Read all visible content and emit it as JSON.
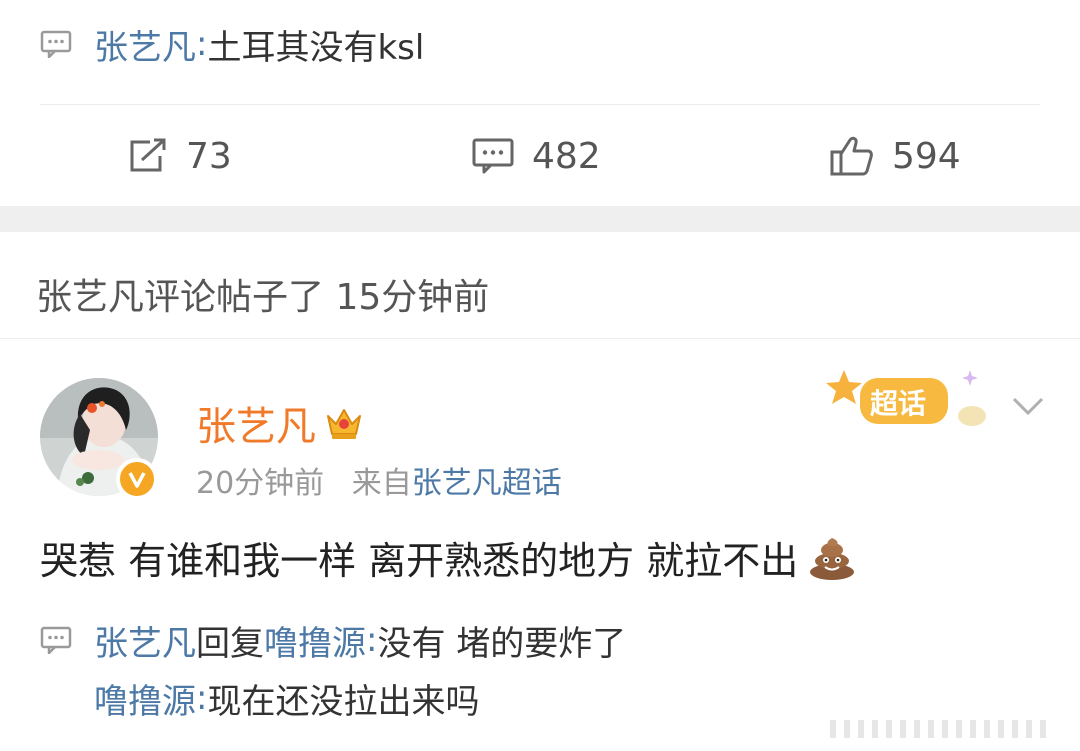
{
  "top_comment": {
    "icon": "comment-bubble-icon",
    "user": "张艺凡",
    "sep": ": ",
    "text": "土耳其没有ksl"
  },
  "actions": {
    "repost": {
      "icon": "repost-icon",
      "count": "73"
    },
    "comment": {
      "icon": "comment-icon",
      "count": "482"
    },
    "like": {
      "icon": "thumbs-up-icon",
      "count": "594"
    }
  },
  "notice": "张艺凡评论帖子了 15分钟前",
  "post": {
    "author": "张艺凡",
    "time": "20分钟前",
    "source_prefix": "来自",
    "source": "张艺凡超话",
    "badge_text": "超话",
    "text": "哭惹 有谁和我一样 离开熟悉的地方 就拉不出",
    "emoji": "poop-emoji"
  },
  "replies": [
    {
      "user": "张艺凡",
      "verb": "回复",
      "target": "噜撸源",
      "sep": ": ",
      "text": "没有 堵的要炸了"
    },
    {
      "user": "噜撸源",
      "sep": ": ",
      "text": "现在还没拉出来吗"
    }
  ],
  "colors": {
    "link": "#4d79a7",
    "username": "#f07a2a",
    "meta": "#999999",
    "badge": "#f5a623"
  }
}
